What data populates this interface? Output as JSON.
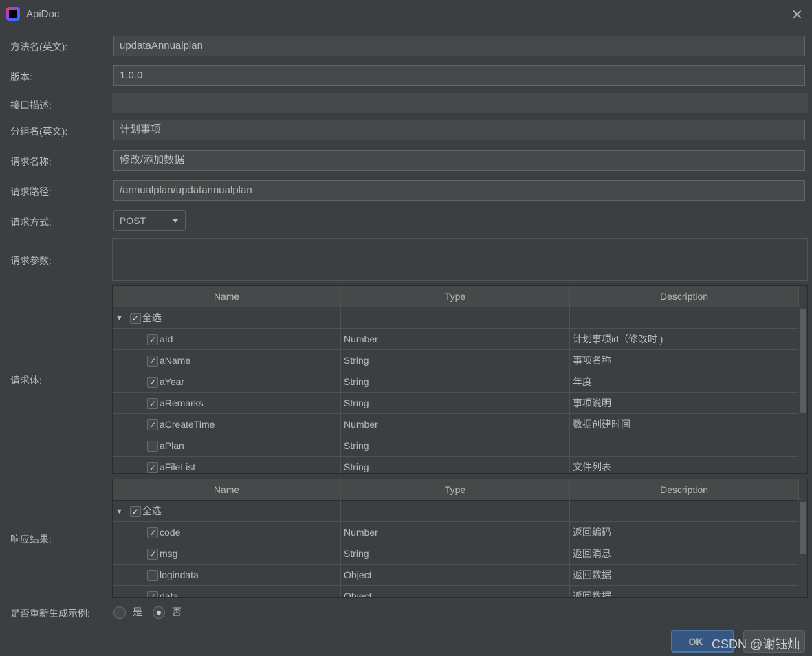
{
  "window": {
    "title": "ApiDoc",
    "close_icon": "close-icon"
  },
  "form": {
    "method_label": "方法名(英文):",
    "method_value": "updataAnnualplan",
    "version_label": "版本:",
    "version_value": "1.0.0",
    "desc_label": "接口描述:",
    "desc_value": "",
    "group_label": "分组名(英文):",
    "group_value": "计划事项",
    "reqname_label": "请求名称:",
    "reqname_value": "修改/添加数据",
    "path_label": "请求路径:",
    "path_value": "/annualplan/updatannualplan",
    "httpmethod_label": "请求方式:",
    "httpmethod_value": "POST",
    "params_label": "请求参数:",
    "params_value": "",
    "body_label": "请求体:",
    "response_label": "响应结果:",
    "regen_label": "是否重新生成示例:",
    "regen_yes": "是",
    "regen_no": "否",
    "regen_selected": "否"
  },
  "body_table": {
    "headers": [
      "Name",
      "Type",
      "Description"
    ],
    "root": {
      "label": "全选",
      "checked": true,
      "expanded": true
    },
    "rows": [
      {
        "name": "aId",
        "type": "Number",
        "desc": "计划事项id（修改时 )",
        "checked": true
      },
      {
        "name": "aName",
        "type": "String",
        "desc": "事项名称",
        "checked": true
      },
      {
        "name": "aYear",
        "type": "String",
        "desc": "年度",
        "checked": true
      },
      {
        "name": "aRemarks",
        "type": "String",
        "desc": "事项说明",
        "checked": true
      },
      {
        "name": "aCreateTime",
        "type": "Number",
        "desc": "数据创建时间",
        "checked": true
      },
      {
        "name": "aPlan",
        "type": "String",
        "desc": "",
        "checked": false
      },
      {
        "name": "aFileList",
        "type": "String",
        "desc": "文件列表",
        "checked": true
      }
    ]
  },
  "response_table": {
    "headers": [
      "Name",
      "Type",
      "Description"
    ],
    "root": {
      "label": "全选",
      "checked": true,
      "expanded": true
    },
    "rows": [
      {
        "name": "code",
        "type": "Number",
        "desc": "返回编码",
        "checked": true
      },
      {
        "name": "msg",
        "type": "String",
        "desc": "返回消息",
        "checked": true
      },
      {
        "name": "logindata",
        "type": "Object",
        "desc": "返回数据",
        "checked": false
      },
      {
        "name": "data",
        "type": "Object",
        "desc": "返回数据",
        "checked": true
      }
    ]
  },
  "buttons": {
    "ok": "OK"
  },
  "watermark": "CSDN @谢钰灿"
}
